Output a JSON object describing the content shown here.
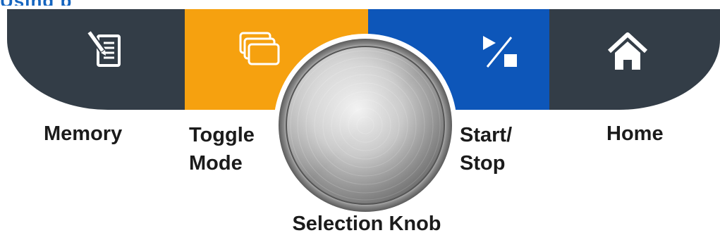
{
  "header": {
    "cut_title": "Using p"
  },
  "panel": {
    "colors": {
      "memory": "#333d47",
      "toggle_mode": "#f6a10f",
      "start_stop": "#0d56b9",
      "home": "#333d47",
      "label_text": "#1b1b1b",
      "title_blue": "#1565c0"
    },
    "buttons": [
      {
        "id": "memory",
        "icon": "notepad-pencil-icon",
        "label_lines": [
          "Memory"
        ]
      },
      {
        "id": "toggle_mode",
        "icon": "stacked-cards-icon",
        "label_lines": [
          "Toggle",
          "Mode"
        ]
      },
      {
        "id": "start_stop",
        "icon": "play-stop-icon",
        "label_lines": [
          "Start/",
          "Stop"
        ]
      },
      {
        "id": "home",
        "icon": "house-icon",
        "label_lines": [
          "Home"
        ]
      }
    ],
    "knob": {
      "icon": "brushed-metal-knob",
      "label": "Selection Knob"
    }
  }
}
